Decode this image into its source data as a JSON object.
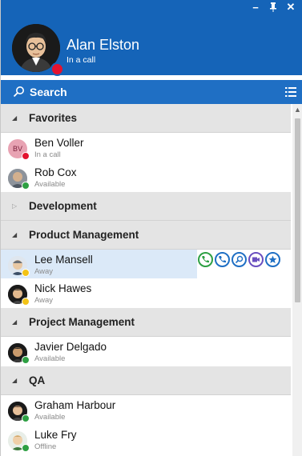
{
  "window": {
    "minimize": "−",
    "pin": "†",
    "close": "✕"
  },
  "user": {
    "name": "Alan Elston",
    "status": "In a call",
    "status_color": "#e3132f"
  },
  "search": {
    "label": "Search",
    "icon": "search-icon",
    "menu_icon": "list-menu-icon"
  },
  "colors": {
    "header": "#1564b8",
    "searchbar": "#1f6fc4",
    "available": "#2ea043",
    "away": "#f3c316",
    "busy": "#e3132f",
    "selected_row": "#dbe9f8"
  },
  "groups": [
    {
      "label": "Favorites",
      "expanded": true
    },
    {
      "label": "Development",
      "expanded": false
    },
    {
      "label": "Product Management",
      "expanded": true
    },
    {
      "label": "Project Management",
      "expanded": true
    },
    {
      "label": "QA",
      "expanded": true
    }
  ],
  "contacts": {
    "ben": {
      "name": "Ben Voller",
      "status": "In a call",
      "initials": "BV"
    },
    "rob": {
      "name": "Rob Cox",
      "status": "Available"
    },
    "lee": {
      "name": "Lee Mansell",
      "status": "Away"
    },
    "nick": {
      "name": "Nick Hawes",
      "status": "Away"
    },
    "javier": {
      "name": "Javier Delgado",
      "status": "Available"
    },
    "graham": {
      "name": "Graham Harbour",
      "status": "Available"
    },
    "luke": {
      "name": "Luke Fry",
      "status": "Offline"
    }
  },
  "actions": [
    {
      "name": "call-icon",
      "color": "#2ea043"
    },
    {
      "name": "transfer-icon",
      "color": "#1f6fc4"
    },
    {
      "name": "search-user-icon",
      "color": "#1f6fc4"
    },
    {
      "name": "video-icon",
      "color": "#6a4fc0"
    },
    {
      "name": "favorite-star-icon",
      "color": "#1f6fc4"
    }
  ]
}
